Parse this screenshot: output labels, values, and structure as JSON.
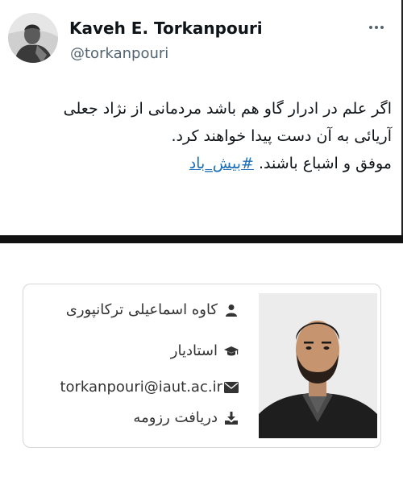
{
  "tweet": {
    "author_name": "Kaveh E. Torkanpouri",
    "author_handle": "@torkanpouri",
    "more_icon": "more-horizontal-icon",
    "body_lines": [
      "اگر علم در ادرار گاو هم باشد مردمانی از نژاد جعلی",
      "آریائی به آن دست پیدا خواهند کرد."
    ],
    "last_line_text": "موفق و اشباع باشند.",
    "hashtag": "#بیش_باد",
    "hashtag_color": "#1d6fb8"
  },
  "profile_card": {
    "name": "کاوه اسماعیلی ترکانپوری",
    "name_icon": "user-icon",
    "title": "استادیار",
    "title_icon": "graduation-cap-icon",
    "email": "torkanpouri@iaut.ac.ir",
    "email_icon": "envelope-icon",
    "cv_label": "دریافت رزومه",
    "cv_icon": "download-icon"
  }
}
